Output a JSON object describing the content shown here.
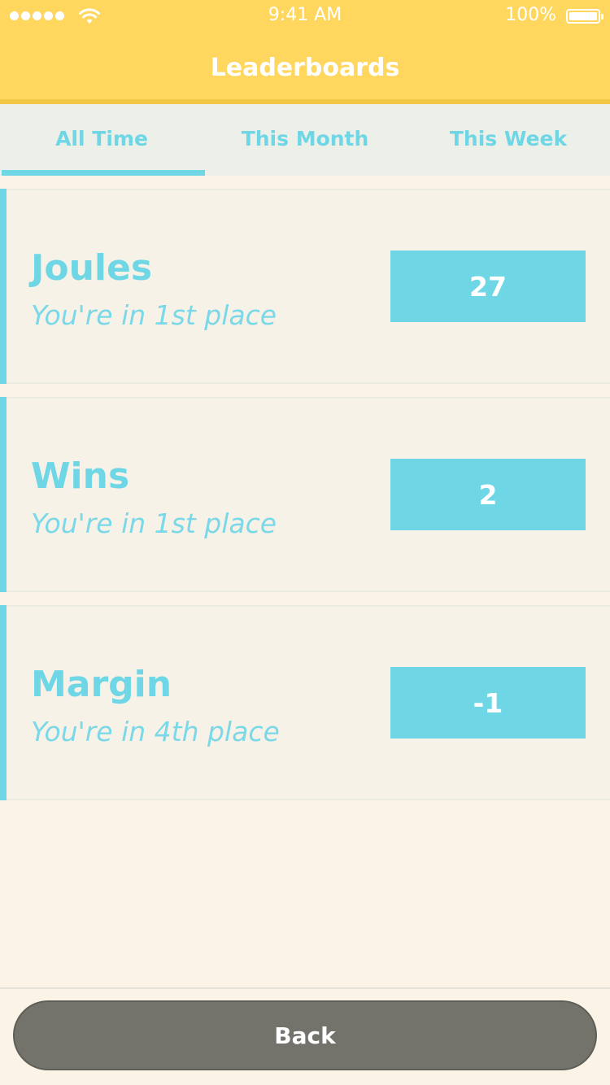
{
  "status_bar": {
    "time": "9:41 AM",
    "battery": "100%",
    "signal_icon": "signal-dots-icon",
    "wifi_icon": "wifi-icon",
    "battery_icon": "battery-icon"
  },
  "header": {
    "title": "Leaderboards",
    "color": "#ffd75f"
  },
  "tabs": [
    {
      "label": "All Time",
      "active": true
    },
    {
      "label": "This Month",
      "active": false
    },
    {
      "label": "This Week",
      "active": false
    }
  ],
  "leaderboards": [
    {
      "name": "Joules",
      "place": "You're in 1st place",
      "score": "27"
    },
    {
      "name": "Wins",
      "place": "You're in 1st place",
      "score": "2"
    },
    {
      "name": "Margin",
      "place": "You're in 4th place",
      "score": "-1"
    }
  ],
  "footer": {
    "back_label": "Back"
  },
  "colors": {
    "accent": "#6fd6e6",
    "button": "#73736c",
    "background": "#fbf4e6"
  }
}
